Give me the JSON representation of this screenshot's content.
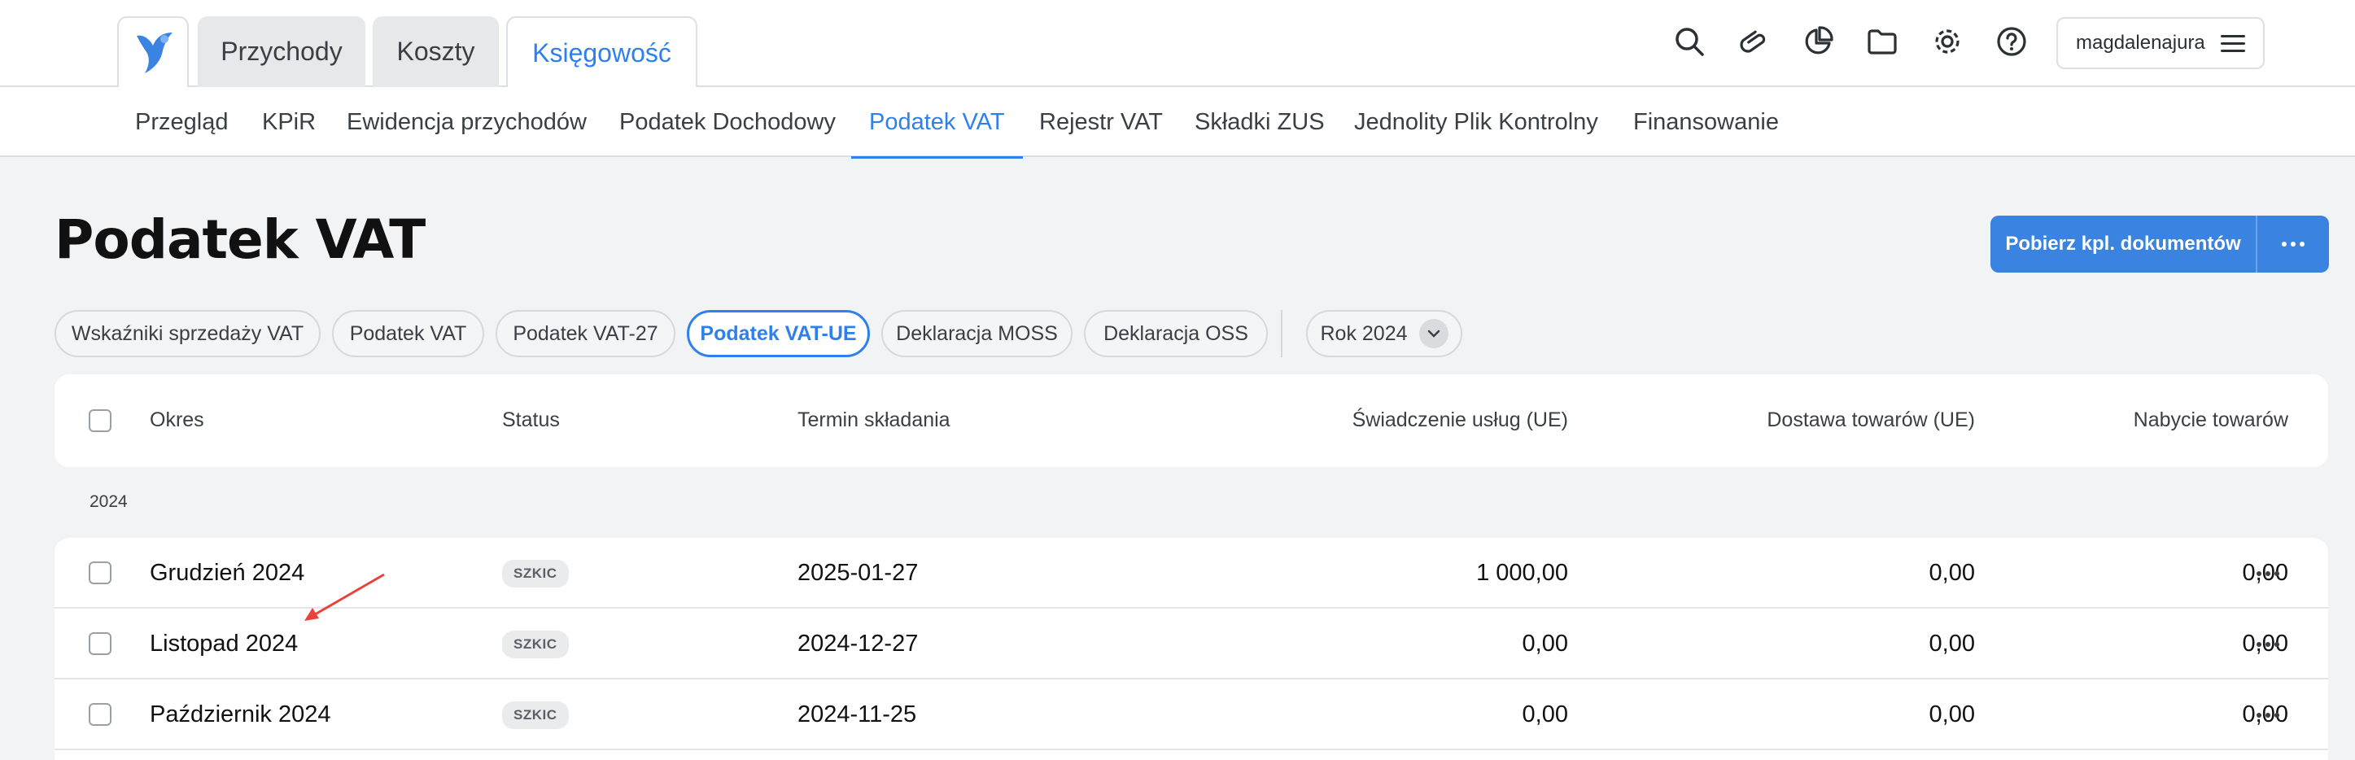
{
  "header": {
    "main_tabs": [
      {
        "label": "Przychody",
        "active": false
      },
      {
        "label": "Koszty",
        "active": false
      },
      {
        "label": "Księgowość",
        "active": true
      }
    ],
    "toolbar_icons": [
      "search-icon",
      "paperclip-icon",
      "pie-chart-icon",
      "folder-icon",
      "gear-icon",
      "help-icon"
    ],
    "username": "magdalenajura"
  },
  "subnav": {
    "items": [
      {
        "label": "Przegląd",
        "active": false
      },
      {
        "label": "KPiR",
        "active": false
      },
      {
        "label": "Ewidencja przychodów",
        "active": false
      },
      {
        "label": "Podatek Dochodowy",
        "active": false
      },
      {
        "label": "Podatek VAT",
        "active": true
      },
      {
        "label": "Rejestr VAT",
        "active": false
      },
      {
        "label": "Składki ZUS",
        "active": false
      },
      {
        "label": "Jednolity Plik Kontrolny",
        "active": false
      },
      {
        "label": "Finansowanie",
        "active": false
      }
    ]
  },
  "page": {
    "title": "Podatek VAT",
    "download_button": "Pobierz kpl. dokumentów"
  },
  "filters": {
    "chips": [
      {
        "label": "Wskaźniki sprzedaży VAT",
        "active": false
      },
      {
        "label": "Podatek VAT",
        "active": false
      },
      {
        "label": "Podatek VAT-27",
        "active": false
      },
      {
        "label": "Podatek VAT-UE",
        "active": true
      },
      {
        "label": "Deklaracja MOSS",
        "active": false
      },
      {
        "label": "Deklaracja OSS",
        "active": false
      }
    ],
    "year_select": "Rok 2024"
  },
  "table": {
    "columns": [
      "Okres",
      "Status",
      "Termin składania",
      "Świadczenie usług (UE)",
      "Dostawa towarów (UE)",
      "Nabycie towarów"
    ],
    "group_label": "2024",
    "rows": [
      {
        "period": "Grudzień 2024",
        "status": "SZKIC",
        "deadline": "2025-01-27",
        "services": "1 000,00",
        "delivery": "0,00",
        "acquisition": "0,00"
      },
      {
        "period": "Listopad 2024",
        "status": "SZKIC",
        "deadline": "2024-12-27",
        "services": "0,00",
        "delivery": "0,00",
        "acquisition": "0,00"
      },
      {
        "period": "Październik 2024",
        "status": "SZKIC",
        "deadline": "2024-11-25",
        "services": "0,00",
        "delivery": "0,00",
        "acquisition": "0,00"
      }
    ]
  },
  "colors": {
    "accent": "#2f80ed",
    "button": "#3a83e0",
    "annotation_arrow": "#e8423a"
  }
}
